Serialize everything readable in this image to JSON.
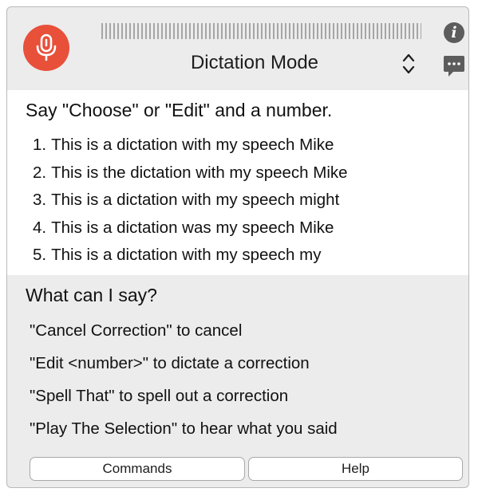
{
  "header": {
    "mode_label": "Dictation Mode"
  },
  "icons": {
    "microphone": "microphone-icon",
    "info": "info-icon",
    "info_glyph": "i",
    "stepper": "up-down-chevron-icon",
    "feedback": "speech-bubble-icon"
  },
  "colors": {
    "mic_button": "#e8503a",
    "window_background": "#ececec",
    "results_background": "#ffffff",
    "icon_gray": "#5c5c5c"
  },
  "results": {
    "prompt": "Say \"Choose\" or \"Edit\" and a number.",
    "candidates": [
      {
        "number": "1.",
        "text": "This is a dictation with my speech Mike"
      },
      {
        "number": "2.",
        "text": "This is the dictation with my speech Mike"
      },
      {
        "number": "3.",
        "text": "This is a dictation with my speech might"
      },
      {
        "number": "4.",
        "text": "This is a dictation was my speech Mike"
      },
      {
        "number": "5.",
        "text": "This is a dictation with my speech my"
      }
    ]
  },
  "help": {
    "title": "What can I say?",
    "hints": [
      "\"Cancel Correction\" to cancel",
      "\"Edit <number>\" to dictate a correction",
      "\"Spell That\" to spell out a correction",
      "\"Play The Selection\" to hear what you said"
    ]
  },
  "buttons": {
    "commands_label": "Commands",
    "help_label": "Help"
  }
}
